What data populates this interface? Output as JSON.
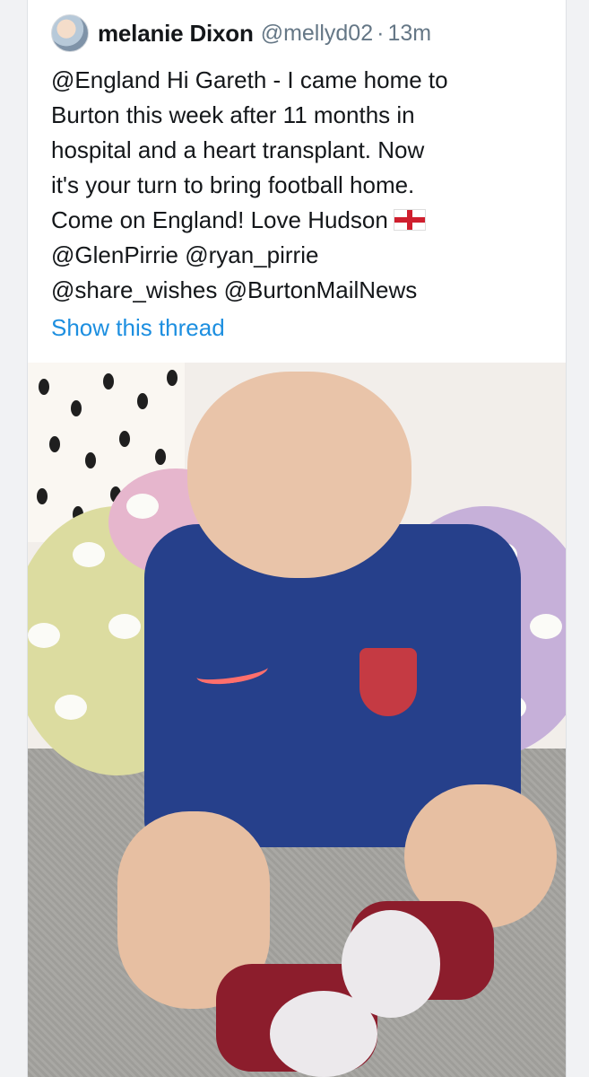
{
  "tweet": {
    "author_name": "melanie Dixon",
    "handle": "@mellyd02",
    "separator": "·",
    "time": "13m",
    "text": "@England Hi Gareth - I came home to\nBurton this week after 11 months in\nhospital and a heart transplant.  Now\nit's your turn to bring football home.\nCome on England! Love Hudson",
    "text_mentions": "@GlenPirrie @ryan_pirrie\n@share_wishes @BurtonMailNews",
    "show_thread": "Show this thread"
  },
  "icons": {
    "avatar": "profile-avatar",
    "flag": "england-flag-icon"
  },
  "colors": {
    "link": "#1d8fe0",
    "secondary_text": "#657786",
    "primary_text": "#14171a"
  }
}
